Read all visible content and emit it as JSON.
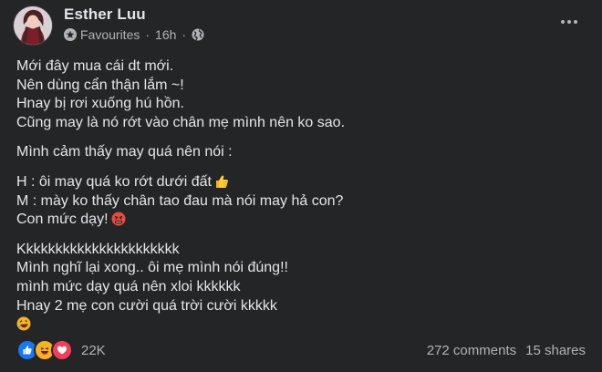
{
  "post": {
    "author": "Esther Luu",
    "audience": "Favourites",
    "time": "16h",
    "separator": "·",
    "paragraphs": [
      {
        "lines": [
          "Mới đây mua cái dt mới.",
          "Nên dùng cẩn thận lắm ~!",
          "Hnay bị rơi xuống hú hồn.",
          "Cũng may là nó rớt vào chân mẹ mình nên ko sao."
        ]
      },
      {
        "lines": [
          "Mình cảm thấy may quá nên nói :"
        ]
      },
      {
        "lines": [
          "H : ôi may quá ko rớt dưới đất",
          "M : mày ko thấy chân tao đau mà nói may hả con?",
          "Con mức dạy!"
        ]
      },
      {
        "lines": [
          "Kkkkkkkkkkkkkkkkkkkkkk",
          "Mình nghĩ lại xong.. ôi mẹ mình nói đúng!!",
          "mình mức dạy quá nên xloi kkkkkk",
          "Hnay 2 mẹ con cười quá trời cười kkkkk"
        ]
      }
    ],
    "emojis": {
      "thumbs_up": "thumbs-up-emoji",
      "angry": "angry-cursing-emoji",
      "laughing": "rolling-laughing-emoji"
    }
  },
  "footer": {
    "reaction_count": "22K",
    "comments": "272 comments",
    "shares": "15 shares"
  },
  "colors": {
    "background": "#242526",
    "text": "#e4e6eb",
    "secondary": "#b0b3b8",
    "like_blue": "#1877f2",
    "haha_yellow": "#f7b125",
    "love_red": "#f33e58"
  }
}
